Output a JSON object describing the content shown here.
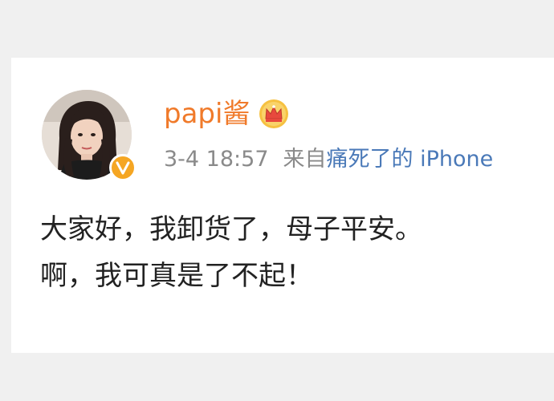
{
  "post": {
    "username": "papi酱",
    "timestamp": "3-4 18:57",
    "from_label": "来自",
    "source": "痛死了的 iPhone",
    "lines": [
      "大家好，我卸货了，母子平安。",
      "啊，我可真是了不起！"
    ]
  },
  "icons": {
    "verified_badge": "verified-v-icon",
    "member_crown": "crown-icon"
  },
  "colors": {
    "username": "#f07a2a",
    "meta": "#8a8a8a",
    "source_link": "#4a79b8",
    "verified_badge": "#f5a623",
    "background": "#f0f0f0"
  }
}
